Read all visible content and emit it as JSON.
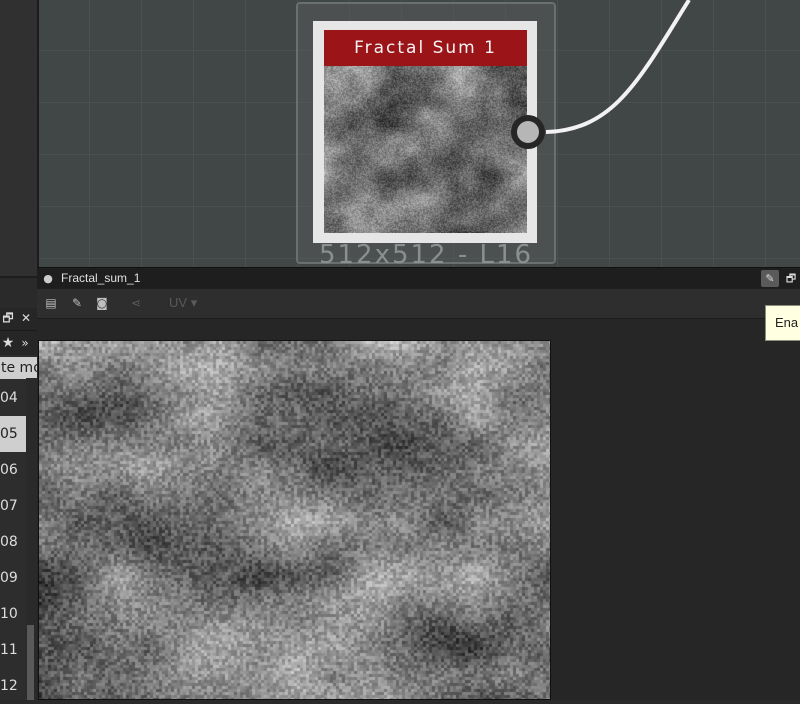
{
  "graph": {
    "node": {
      "title": "Fractal Sum 1",
      "size_label": "512x512 - L16",
      "header_color": "#9b1418"
    }
  },
  "view2d": {
    "title": "Fractal_sum_1",
    "toolbar": {
      "uv_label": "UV",
      "uv_arrow": "▾"
    },
    "tooltip": "Ena"
  },
  "left_panel": {
    "partial_text": "te mo",
    "rows": [
      "04",
      "05",
      "06",
      "07",
      "08",
      "09",
      "10",
      "11",
      "12"
    ],
    "selected_row": "05"
  },
  "icons": {
    "view": "node-icon",
    "pin": "pin-icon",
    "float": "float-window-icon",
    "close": "close-icon",
    "star": "star-icon",
    "more": "chevron-double-right-icon",
    "toolbar": [
      "channels-icon",
      "edit-icon",
      "camera-icon",
      "share-icon"
    ]
  }
}
